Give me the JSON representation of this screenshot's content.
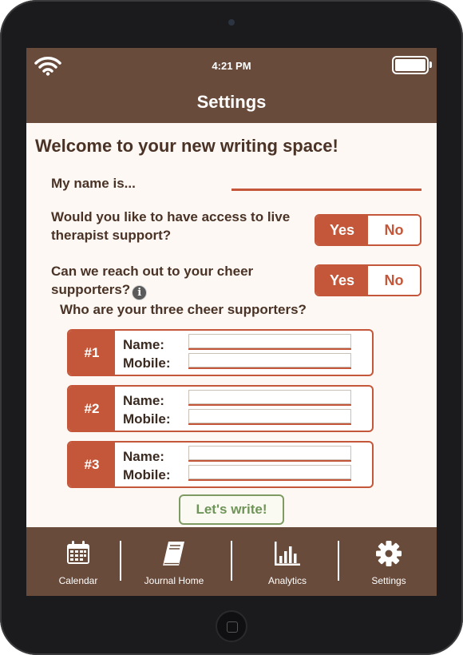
{
  "status_bar": {
    "time": "4:21 PM"
  },
  "header": {
    "title": "Settings"
  },
  "main": {
    "welcome": "Welcome to your new writing space!",
    "name_label": "My name is...",
    "therapist_question": "Would you like to have access to live therapist support?",
    "therapist_toggle": {
      "yes": "Yes",
      "no": "No",
      "selected": "Yes"
    },
    "cheer_question": "Can we reach out to your cheer supporters?",
    "cheer_toggle": {
      "yes": "Yes",
      "no": "No",
      "selected": "Yes"
    },
    "supporters_heading": "Who are your three cheer supporters?",
    "supporters": [
      {
        "number": "#1",
        "name_label": "Name:",
        "mobile_label": "Mobile:"
      },
      {
        "number": "#2",
        "name_label": "Name:",
        "mobile_label": "Mobile:"
      },
      {
        "number": "#3",
        "name_label": "Name:",
        "mobile_label": "Mobile:"
      }
    ],
    "submit_label": "Let's write!"
  },
  "tabbar": {
    "tabs": [
      {
        "label": "Calendar",
        "icon": "calendar-icon"
      },
      {
        "label": "Journal Home",
        "icon": "journal-icon"
      },
      {
        "label": "Analytics",
        "icon": "analytics-icon"
      },
      {
        "label": "Settings",
        "icon": "gear-icon"
      }
    ]
  },
  "colors": {
    "brand_brown": "#684b3b",
    "accent_orange": "#c4573a",
    "accent_green": "#7d9b63",
    "background": "#fdf8f3"
  }
}
